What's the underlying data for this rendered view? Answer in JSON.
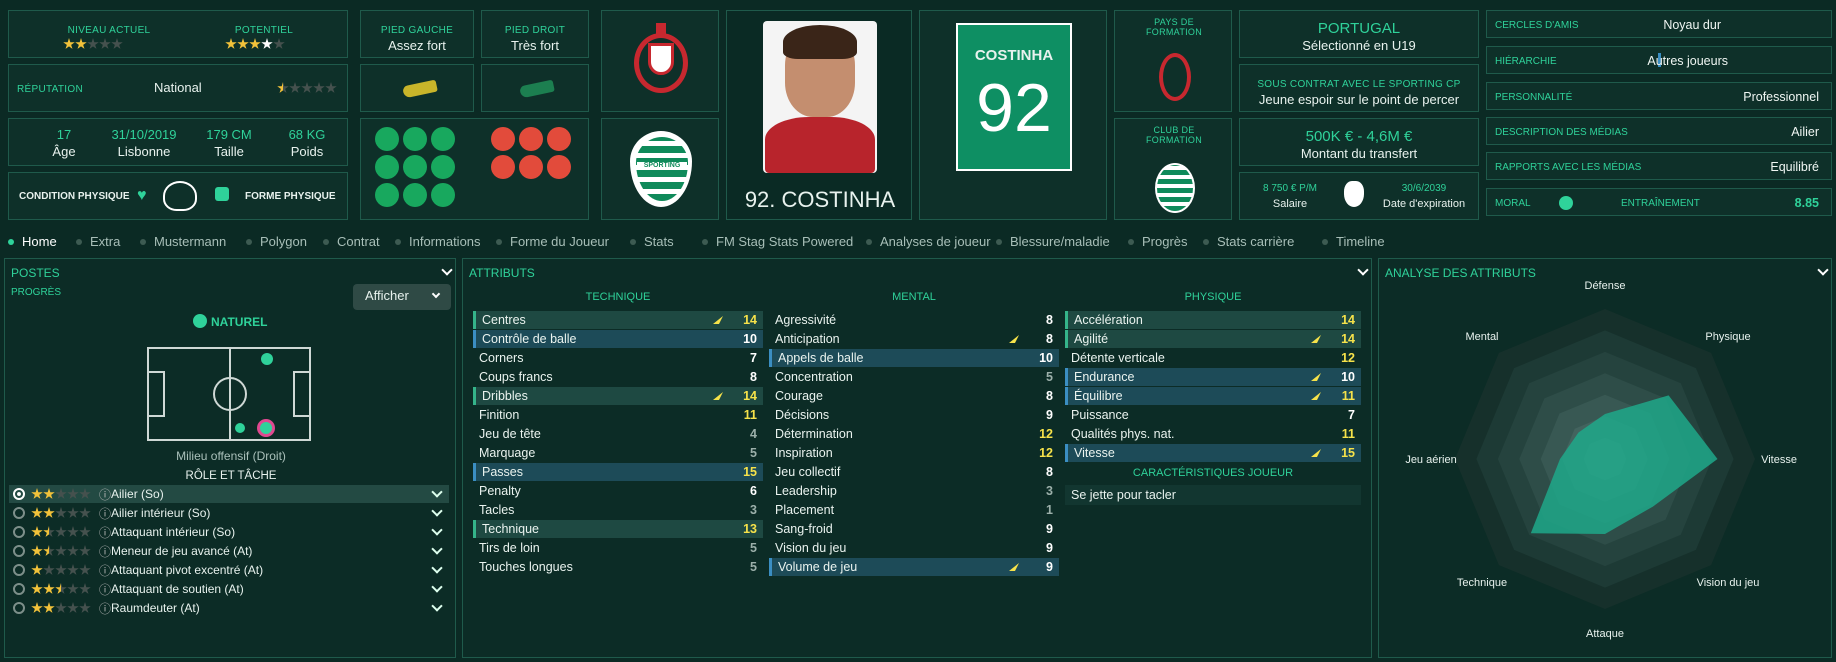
{
  "header": {
    "level_label": "NIVEAU ACTUEL",
    "potential_label": "POTENTIEL",
    "reputation_label": "RÉPUTATION",
    "reputation_value": "National",
    "age_value": "17",
    "age_label": "Âge",
    "birth_date": "31/10/2019",
    "birth_place": "Lisbonne",
    "height_value": "179 CM",
    "height_label": "Taille",
    "weight_value": "68 KG",
    "weight_label": "Poids",
    "condition_label": "CONDITION PHYSIQUE",
    "form_label": "FORME PHYSIQUE",
    "left_foot_label": "PIED GAUCHE",
    "left_foot_value": "Assez fort",
    "right_foot_label": "PIED DROIT",
    "right_foot_value": "Très fort",
    "shirt_name": "COSTINHA",
    "shirt_number": "92",
    "player_name": "92. COSTINHA",
    "country_label": "PAYS DE FORMATION",
    "club_label": "CLUB DE FORMATION",
    "nation": "PORTUGAL",
    "nation_status": "Sélectionné en U19",
    "contract_label": "SOUS CONTRAT AVEC LE SPORTING CP",
    "contract_value": "Jeune espoir sur le point de percer",
    "transfer_value": "500K € - 4,6M €",
    "transfer_label": "Montant du transfert",
    "salary_value": "8 750 € P/M",
    "salary_label": "Salaire",
    "expiry_value": "30/6/2039",
    "expiry_label": "Date d'expiration",
    "sporting_text": "SPORTING"
  },
  "right_info": [
    {
      "label": "CERCLES D'AMIS",
      "value": "Noyau dur"
    },
    {
      "label": "HIÉRARCHIE",
      "value": "Autres joueurs"
    },
    {
      "label": "PERSONNALITÉ",
      "value": "Professionnel"
    },
    {
      "label": "DESCRIPTION DES MÉDIAS",
      "value": "Ailier"
    },
    {
      "label": "RAPPORTS AVEC LES MÉDIAS",
      "value": "Equilibré"
    }
  ],
  "morale": {
    "label": "MORAL",
    "training_label": "ENTRAÎNEMENT",
    "training_value": "8.85"
  },
  "tabs": [
    "Home",
    "Extra",
    "Mustermann",
    "Polygon",
    "Contrat",
    "Informations",
    "Forme du Joueur",
    "Stats",
    "FM Stag Stats Powered",
    "Analyses de joueur",
    "Blessure/maladie",
    "Progrès",
    "Stats carrière",
    "Timeline"
  ],
  "positions": {
    "title": "POSTES",
    "progress": "PROGRÈS",
    "show_button": "Afficher",
    "natural": "NATUREL",
    "position_name": "Milieu offensif (Droit)",
    "role_title": "RÔLE ET TÂCHE",
    "roles": [
      "Ailier (So)",
      "Ailier intérieur (So)",
      "Attaquant intérieur (So)",
      "Meneur de jeu avancé (At)",
      "Attaquant pivot excentré (At)",
      "Attaquant de soutien (At)",
      "Raumdeuter (At)"
    ]
  },
  "attributes": {
    "title": "ATTRIBUTS",
    "technical_label": "TECHNIQUE",
    "mental_label": "MENTAL",
    "physical_label": "PHYSIQUE",
    "technical": [
      [
        "Centres",
        "14"
      ],
      [
        "Contrôle de balle",
        "10"
      ],
      [
        "Corners",
        "7"
      ],
      [
        "Coups francs",
        "8"
      ],
      [
        "Dribbles",
        "14"
      ],
      [
        "Finition",
        "11"
      ],
      [
        "Jeu de tête",
        "4"
      ],
      [
        "Marquage",
        "5"
      ],
      [
        "Passes",
        "15"
      ],
      [
        "Penalty",
        "6"
      ],
      [
        "Tacles",
        "3"
      ],
      [
        "Technique",
        "13"
      ],
      [
        "Tirs de loin",
        "5"
      ],
      [
        "Touches longues",
        "5"
      ]
    ],
    "mental": [
      [
        "Agressivité",
        "8"
      ],
      [
        "Anticipation",
        "8"
      ],
      [
        "Appels de balle",
        "10"
      ],
      [
        "Concentration",
        "5"
      ],
      [
        "Courage",
        "8"
      ],
      [
        "Décisions",
        "9"
      ],
      [
        "Détermination",
        "12"
      ],
      [
        "Inspiration",
        "12"
      ],
      [
        "Jeu collectif",
        "8"
      ],
      [
        "Leadership",
        "3"
      ],
      [
        "Placement",
        "1"
      ],
      [
        "Sang-froid",
        "9"
      ],
      [
        "Vision du jeu",
        "9"
      ],
      [
        "Volume de jeu",
        "9"
      ]
    ],
    "physical": [
      [
        "Accélération",
        "14"
      ],
      [
        "Agilité",
        "14"
      ],
      [
        "Détente verticale",
        "12"
      ],
      [
        "Endurance",
        "10"
      ],
      [
        "Équilibre",
        "11"
      ],
      [
        "Puissance",
        "7"
      ],
      [
        "Qualités phys. nat.",
        "11"
      ],
      [
        "Vitesse",
        "15"
      ]
    ],
    "traits_label": "CARACTÉRISTIQUES JOUEUR",
    "trait": "Se jette pour tacler"
  },
  "analysis": {
    "title": "ANALYSE DES ATTRIBUTS",
    "axes": [
      "Défense",
      "Physique",
      "Vitesse",
      "Vision du jeu",
      "Attaque",
      "Technique",
      "Jeu aérien",
      "Mental"
    ],
    "values": [
      0.3,
      0.6,
      0.75,
      0.45,
      0.5,
      0.7,
      0.3,
      0.25
    ]
  }
}
